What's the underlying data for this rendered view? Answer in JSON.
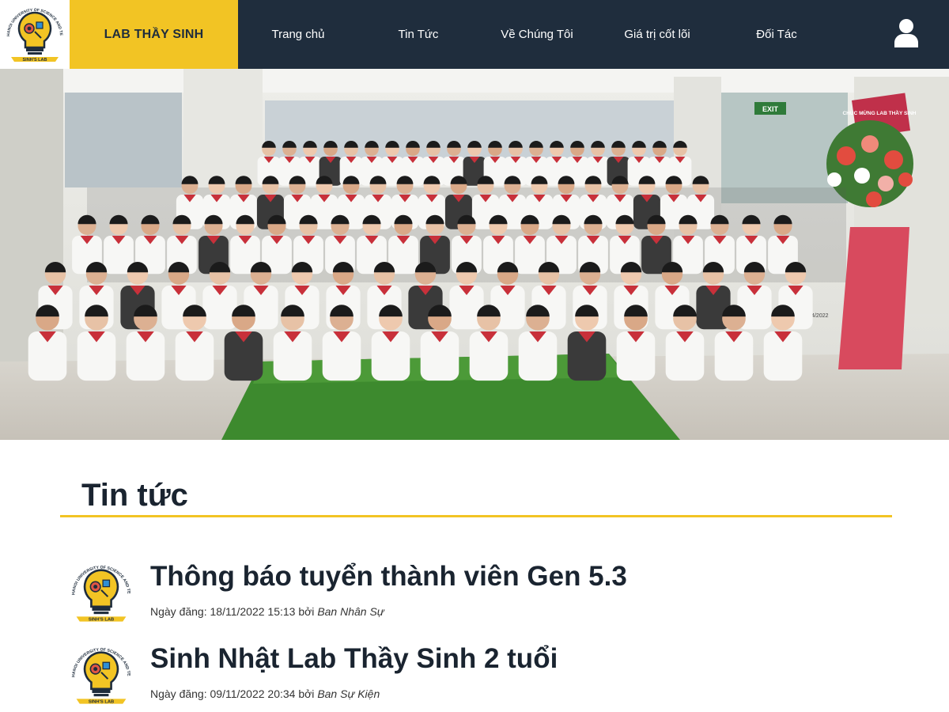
{
  "header": {
    "logo_text_top": "HANOI UNIVERSITY OF SCIENCE AND TECHNOLOGY",
    "logo_text_bottom": "SINH'S LAB",
    "brand": "LAB THẦY SINH",
    "nav": [
      "Trang chủ",
      "Tin Tức",
      "Về Chúng Tôi",
      "Giá trị cốt lõi",
      "Đối Tác"
    ],
    "user_icon": "user-icon"
  },
  "hero": {
    "banner_text": "CHÚC MỪNG LAB THẦY SINH",
    "exit_sign": "EXIT",
    "date_sign": "20/04/2022"
  },
  "news": {
    "heading": "Tin tức",
    "articles": [
      {
        "title": "Thông báo tuyển thành viên Gen 5.3",
        "meta_prefix": "Ngày đăng: 18/11/2022 15:13 bởi ",
        "author": "Ban Nhân Sự"
      },
      {
        "title": "Sinh Nhật Lab Thầy Sinh 2 tuổi",
        "meta_prefix": "Ngày đăng: 09/11/2022 20:34 bởi ",
        "author": "Ban Sự Kiện"
      }
    ]
  },
  "colors": {
    "header_bg": "#1f2d3d",
    "accent_yellow": "#f2c424",
    "text_dark": "#1a2430"
  }
}
